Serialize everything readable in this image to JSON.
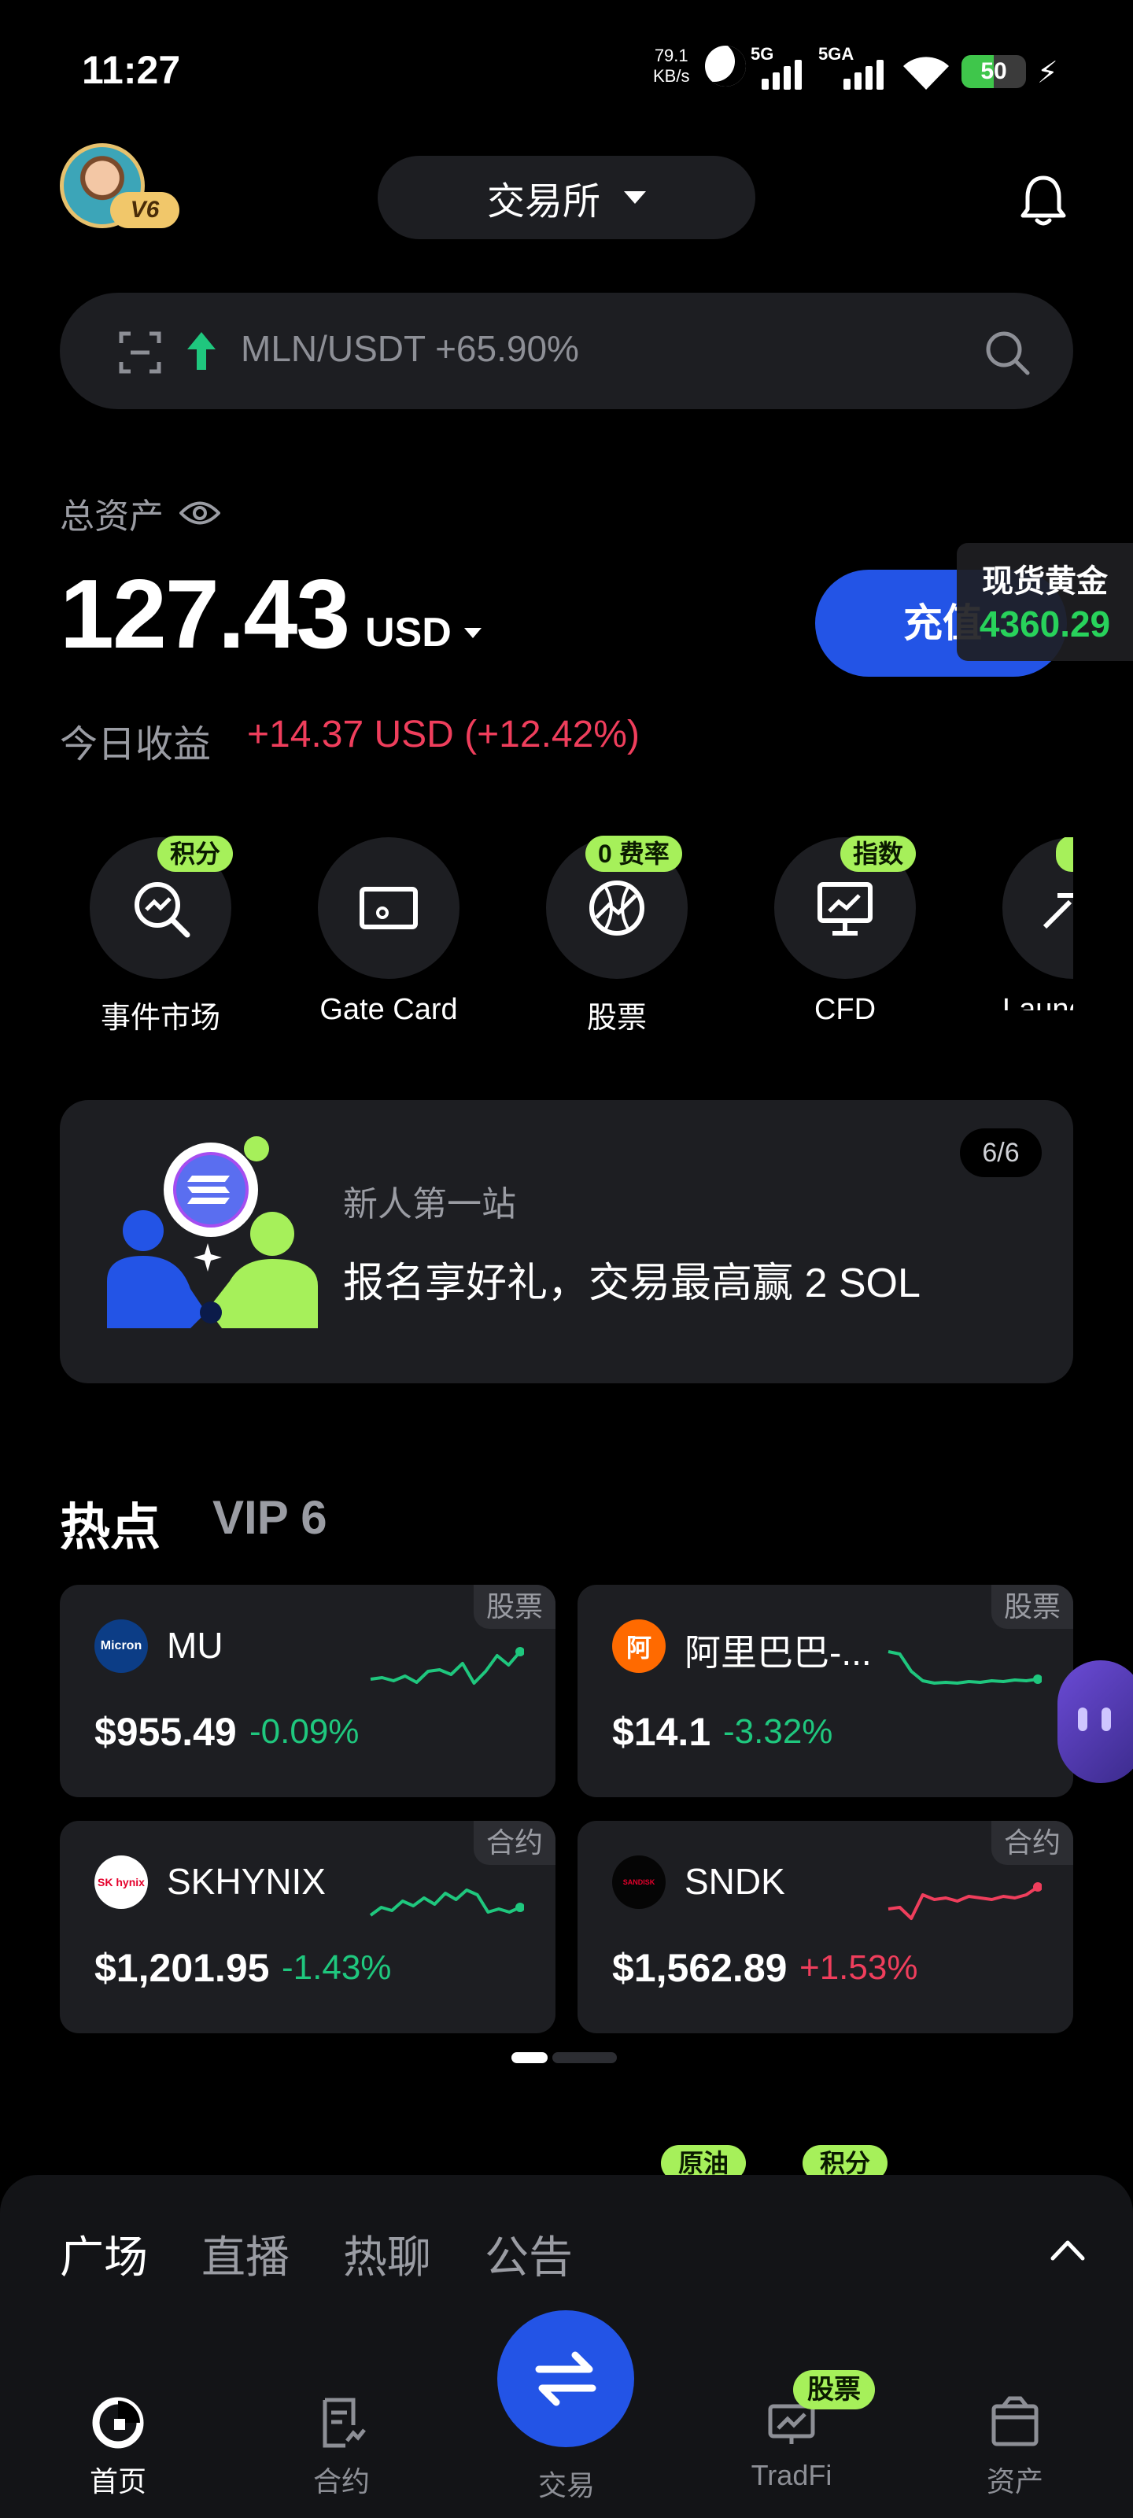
{
  "status_bar": {
    "time": "11:27",
    "net_speed_value": "79.1",
    "net_speed_unit": "KB/s",
    "signal1_label": "5G",
    "signal2_label": "5GA",
    "battery": "50",
    "battery_level": 0.5
  },
  "header": {
    "vip_badge": "V6",
    "exchange_label": "交易所"
  },
  "search": {
    "trending_text": "MLN/USDT +65.90%"
  },
  "assets": {
    "label": "总资产",
    "total": "127.43",
    "currency": "USD",
    "deposit_label": "充值",
    "today_label": "今日收益",
    "today_value": "+14.37 USD (+12.42%)"
  },
  "gold_widget": {
    "title": "现货黄金",
    "price": "4360.29"
  },
  "quick_actions": [
    {
      "label": "事件市场",
      "tag": "积分",
      "icon": "event-market-icon"
    },
    {
      "label": "Gate Card",
      "tag": "",
      "icon": "card-icon"
    },
    {
      "label": "股票",
      "tag": "0 费率",
      "icon": "globe-icon"
    },
    {
      "label": "CFD",
      "tag": "指数",
      "icon": "chart-board-icon"
    },
    {
      "label": "Launc",
      "tag": "",
      "icon": "launch-icon"
    }
  ],
  "promo": {
    "subtitle": "新人第一站",
    "title": "报名享好礼，交易最高赢 2 SOL",
    "page": "6/6"
  },
  "hot": {
    "title": "热点",
    "vip_label": "VIP 6",
    "cards": [
      {
        "name": "MU",
        "tag": "股票",
        "price": "$955.49",
        "change": "-0.09%",
        "trend": "down",
        "logo_text": "Micron",
        "spark": [
          40,
          38,
          42,
          36,
          44,
          30,
          28,
          34,
          20,
          45,
          30,
          10,
          22,
          5
        ]
      },
      {
        "name": "阿里巴巴-...",
        "tag": "股票",
        "price": "$14.1",
        "change": "-3.32%",
        "trend": "down",
        "logo_text": "阿",
        "spark": [
          5,
          8,
          30,
          42,
          45,
          44,
          45,
          43,
          44,
          42,
          43,
          41,
          42,
          40
        ]
      },
      {
        "name": "SKHYNIX",
        "tag": "合约",
        "price": "$1,201.95",
        "change": "-1.43%",
        "trend": "down",
        "logo_text": "SK hynix",
        "spark": [
          40,
          30,
          34,
          22,
          28,
          18,
          26,
          12,
          20,
          8,
          14,
          36,
          32,
          36,
          30
        ]
      },
      {
        "name": "SNDK",
        "tag": "合约",
        "price": "$1,562.89",
        "change": "+1.53%",
        "trend": "up",
        "logo_text": "SANDISK",
        "spark": [
          32,
          30,
          44,
          14,
          20,
          18,
          22,
          16,
          18,
          20,
          16,
          18,
          14,
          4
        ]
      }
    ]
  },
  "peek_tags": [
    "原油",
    "积分"
  ],
  "bottom_sheet": {
    "tabs": [
      "广场",
      "直播",
      "热聊",
      "公告"
    ]
  },
  "bottom_nav": {
    "items": [
      {
        "label": "首页",
        "icon": "home-icon"
      },
      {
        "label": "合约",
        "icon": "contract-icon"
      },
      {
        "label": "交易",
        "icon": "swap-icon"
      },
      {
        "label": "TradFi",
        "icon": "tradfi-icon"
      },
      {
        "label": "资产",
        "icon": "wallet-icon"
      }
    ],
    "tradfi_tag": "股票"
  },
  "colors": {
    "background": "#000000",
    "card": "#1d1e22",
    "accent_blue": "#2354e6",
    "green": "#1fc77e",
    "red": "#ef3e5c",
    "tag_green": "#a6f05a"
  }
}
